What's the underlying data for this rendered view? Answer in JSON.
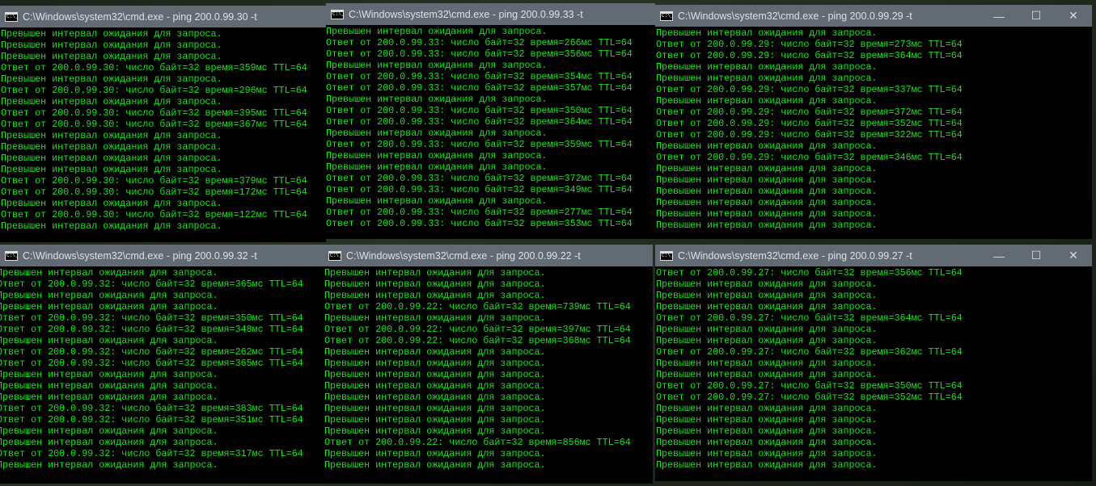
{
  "colors": {
    "console_text": "#12e412",
    "console_bg": "#000000",
    "titlebar": "#626a74"
  },
  "controls": {
    "minimize": "—",
    "maximize": "☐",
    "close": "✕"
  },
  "windows": [
    {
      "title": "C:\\Windows\\system32\\cmd.exe - ping  200.0.99.30 -t",
      "lines": [
        "Превышен интервал ожидания для запроса.",
        "Превышен интервал ожидания для запроса.",
        "Превышен интервал ожидания для запроса.",
        "Ответ от 200.0.99.30: число байт=32 время=359мс TTL=64",
        "Превышен интервал ожидания для запроса.",
        "Ответ от 200.0.99.30: число байт=32 время=296мс TTL=64",
        "Превышен интервал ожидания для запроса.",
        "Ответ от 200.0.99.30: число байт=32 время=395мс TTL=64",
        "Ответ от 200.0.99.30: число байт=32 время=367мс TTL=64",
        "Превышен интервал ожидания для запроса.",
        "Превышен интервал ожидания для запроса.",
        "Превышен интервал ожидания для запроса.",
        "Превышен интервал ожидания для запроса.",
        "Ответ от 200.0.99.30: число байт=32 время=379мс TTL=64",
        "Ответ от 200.0.99.30: число байт=32 время=172мс TTL=64",
        "Превышен интервал ожидания для запроса.",
        "Ответ от 200.0.99.30: число байт=32 время=122мс TTL=64",
        "Превышен интервал ожидания для запроса."
      ]
    },
    {
      "title": "C:\\Windows\\system32\\cmd.exe - ping  200.0.99.33 -t",
      "lines": [
        "Превышен интервал ожидания для запроса.",
        "Ответ от 200.0.99.33: число байт=32 время=266мс TTL=64",
        "Ответ от 200.0.99.33: число байт=32 время=356мс TTL=64",
        "Превышен интервал ожидания для запроса.",
        "Ответ от 200.0.99.33: число байт=32 время=354мс TTL=64",
        "Ответ от 200.0.99.33: число байт=32 время=357мс TTL=64",
        "Превышен интервал ожидания для запроса.",
        "Ответ от 200.0.99.33: число байт=32 время=350мс TTL=64",
        "Ответ от 200.0.99.33: число байт=32 время=364мс TTL=64",
        "Превышен интервал ожидания для запроса.",
        "Ответ от 200.0.99.33: число байт=32 время=359мс TTL=64",
        "Превышен интервал ожидания для запроса.",
        "Превышен интервал ожидания для запроса.",
        "Ответ от 200.0.99.33: число байт=32 время=372мс TTL=64",
        "Ответ от 200.0.99.33: число байт=32 время=349мс TTL=64",
        "Превышен интервал ожидания для запроса.",
        "Ответ от 200.0.99.33: число байт=32 время=277мс TTL=64",
        "Ответ от 200.0.99.33: число байт=32 время=353мс TTL=64"
      ]
    },
    {
      "title": "C:\\Windows\\system32\\cmd.exe - ping  200.0.99.29 -t",
      "lines": [
        "Превышен интервал ожидания для запроса.",
        "Ответ от 200.0.99.29: число байт=32 время=273мс TTL=64",
        "Ответ от 200.0.99.29: число байт=32 время=364мс TTL=64",
        "Превышен интервал ожидания для запроса.",
        "Превышен интервал ожидания для запроса.",
        "Ответ от 200.0.99.29: число байт=32 время=337мс TTL=64",
        "Превышен интервал ожидания для запроса.",
        "Ответ от 200.0.99.29: число байт=32 время=372мс TTL=64",
        "Ответ от 200.0.99.29: число байт=32 время=352мс TTL=64",
        "Ответ от 200.0.99.29: число байт=32 время=322мс TTL=64",
        "Превышен интервал ожидания для запроса.",
        "Ответ от 200.0.99.29: число байт=32 время=346мс TTL=64",
        "Превышен интервал ожидания для запроса.",
        "Превышен интервал ожидания для запроса.",
        "Превышен интервал ожидания для запроса.",
        "Превышен интервал ожидания для запроса.",
        "Превышен интервал ожидания для запроса.",
        "Превышен интервал ожидания для запроса."
      ]
    },
    {
      "title": "C:\\Windows\\system32\\cmd.exe - ping  200.0.99.32 -t",
      "lines": [
        "Превышен интервал ожидания для запроса.",
        "Ответ от 200.0.99.32: число байт=32 время=365мс TTL=64",
        "Превышен интервал ожидания для запроса.",
        "Превышен интервал ожидания для запроса.",
        "Ответ от 200.0.99.32: число байт=32 время=350мс TTL=64",
        "Ответ от 200.0.99.32: число байт=32 время=348мс TTL=64",
        "Превышен интервал ожидания для запроса.",
        "Ответ от 200.0.99.32: число байт=32 время=262мс TTL=64",
        "Ответ от 200.0.99.32: число байт=32 время=365мс TTL=64",
        "Превышен интервал ожидания для запроса.",
        "Превышен интервал ожидания для запроса.",
        "Превышен интервал ожидания для запроса.",
        "Ответ от 200.0.99.32: число байт=32 время=383мс TTL=64",
        "Ответ от 200.0.99.32: число байт=32 время=351мс TTL=64",
        "Превышен интервал ожидания для запроса.",
        "Превышен интервал ожидания для запроса.",
        "Ответ от 200.0.99.32: число байт=32 время=317мс TTL=64",
        "Превышен интервал ожидания для запроса."
      ]
    },
    {
      "title": "C:\\Windows\\system32\\cmd.exe - ping  200.0.99.22 -t",
      "lines": [
        "Превышен интервал ожидания для запроса.",
        "Превышен интервал ожидания для запроса.",
        "Превышен интервал ожидания для запроса.",
        "Ответ от 200.0.99.22: число байт=32 время=739мс TTL=64",
        "Превышен интервал ожидания для запроса.",
        "Ответ от 200.0.99.22: число байт=32 время=397мс TTL=64",
        "Ответ от 200.0.99.22: число байт=32 время=368мс TTL=64",
        "Превышен интервал ожидания для запроса.",
        "Превышен интервал ожидания для запроса.",
        "Превышен интервал ожидания для запроса.",
        "Превышен интервал ожидания для запроса.",
        "Превышен интервал ожидания для запроса.",
        "Превышен интервал ожидания для запроса.",
        "Превышен интервал ожидания для запроса.",
        "Превышен интервал ожидания для запроса.",
        "Ответ от 200.0.99.22: число байт=32 время=856мс TTL=64",
        "Превышен интервал ожидания для запроса.",
        "Превышен интервал ожидания для запроса."
      ]
    },
    {
      "title": "C:\\Windows\\system32\\cmd.exe - ping  200.0.99.27 -t",
      "lines": [
        "Ответ от 200.0.99.27: число байт=32 время=356мс TTL=64",
        "Превышен интервал ожидания для запроса.",
        "Превышен интервал ожидания для запроса.",
        "Превышен интервал ожидания для запроса.",
        "Ответ от 200.0.99.27: число байт=32 время=364мс TTL=64",
        "Превышен интервал ожидания для запроса.",
        "Превышен интервал ожидания для запроса.",
        "Ответ от 200.0.99.27: число байт=32 время=362мс TTL=64",
        "Превышен интервал ожидания для запроса.",
        "Превышен интервал ожидания для запроса.",
        "Ответ от 200.0.99.27: число байт=32 время=350мс TTL=64",
        "Ответ от 200.0.99.27: число байт=32 время=352мс TTL=64",
        "Превышен интервал ожидания для запроса.",
        "Превышен интервал ожидания для запроса.",
        "Превышен интервал ожидания для запроса.",
        "Превышен интервал ожидания для запроса.",
        "Превышен интервал ожидания для запроса.",
        "Превышен интервал ожидания для запроса."
      ]
    }
  ]
}
